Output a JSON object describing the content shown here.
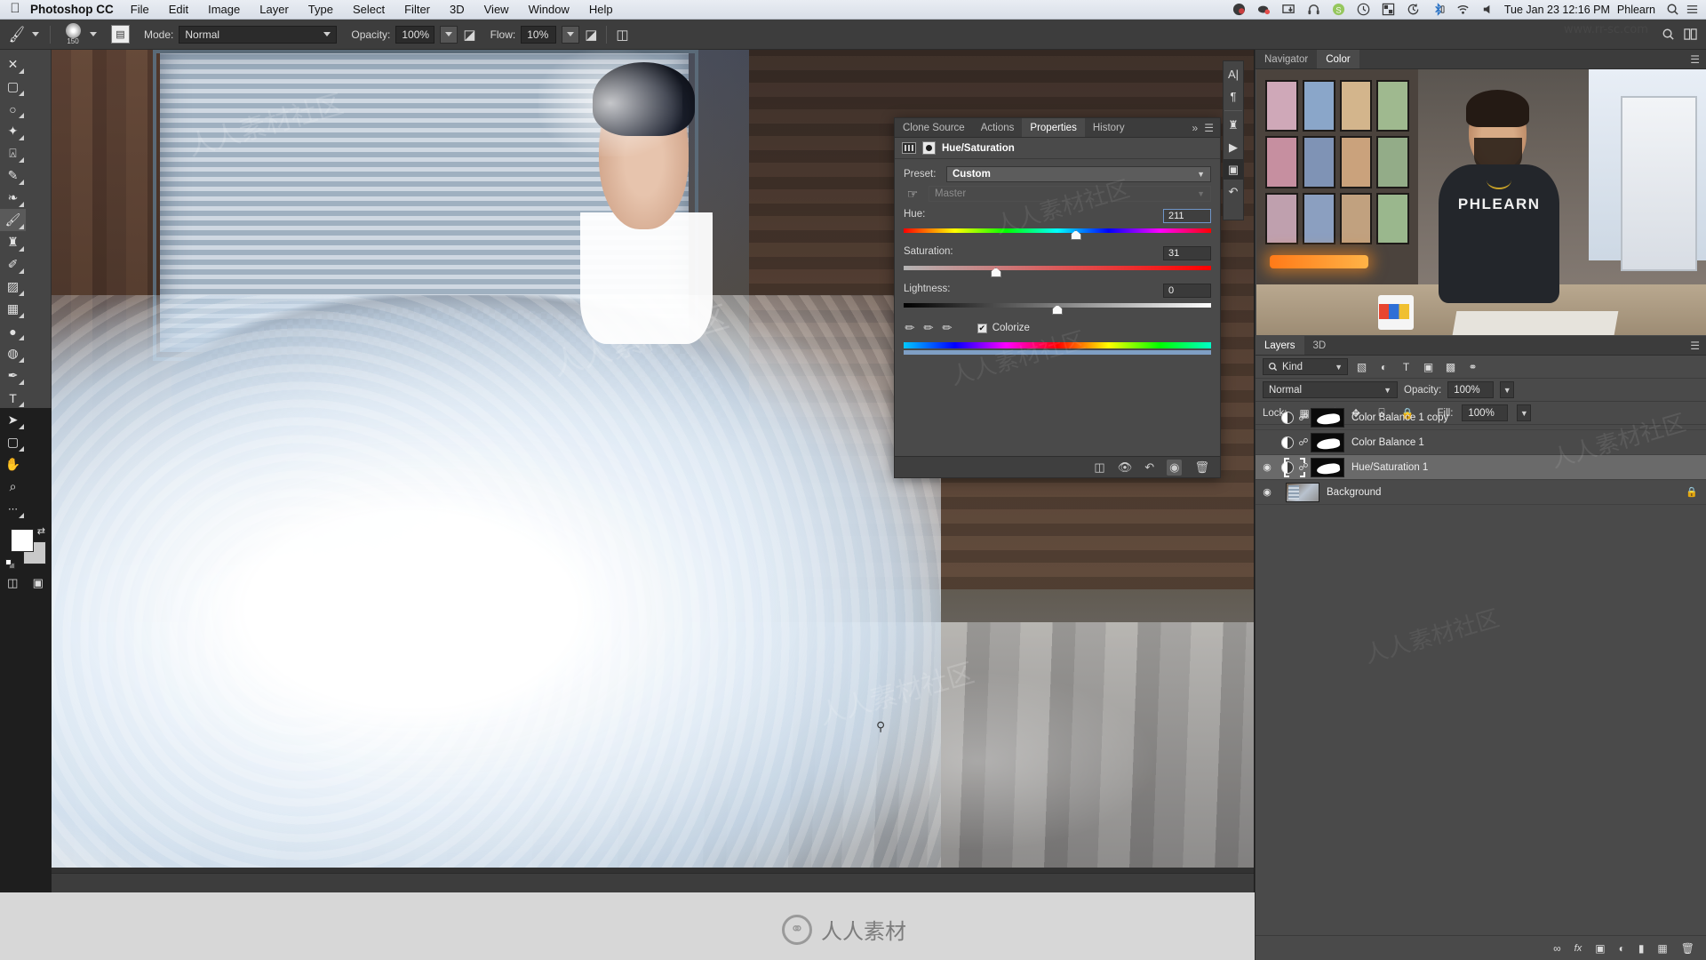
{
  "menubar": {
    "apple_icon": "apple-icon",
    "app_name": "Photoshop CC",
    "items": [
      "File",
      "Edit",
      "Image",
      "Layer",
      "Type",
      "Select",
      "Filter",
      "3D",
      "View",
      "Window",
      "Help"
    ],
    "tray_icons": [
      "dropbox-icon",
      "cloud-sync-icon",
      "display-link-icon",
      "headphone-icon",
      "skype-icon",
      "clock-icon",
      "grid-icon",
      "timemachine-icon",
      "bluetooth-icon",
      "wifi-icon",
      "input-source-icon",
      "battery-icon",
      "volume-icon"
    ],
    "datetime": "Tue Jan 23  12:16 PM",
    "user": "Phlearn",
    "search_icon": "search-icon",
    "control_center_icon": "list-icon"
  },
  "optionsbar": {
    "tool_icon": "brush-tool-icon",
    "brush_size": "150",
    "tablet_pressure_icon": "tablet-icon",
    "mode_label": "Mode:",
    "mode_value": "Normal",
    "opacity_label": "Opacity:",
    "opacity_value": "100%",
    "opacity_pressure_icon": "pressure-opacity-icon",
    "flow_label": "Flow:",
    "flow_value": "10%",
    "airbrush_icon": "airbrush-icon",
    "smoothing_icon": "smoothing-icon",
    "search_icon": "search-icon",
    "arrange_icon": "arrange-icon"
  },
  "toolbar": {
    "tools": [
      {
        "name": "move-tool",
        "glyph": "✥",
        "active": false
      },
      {
        "name": "marquee-tool",
        "glyph": "▭",
        "active": false
      },
      {
        "name": "lasso-tool",
        "glyph": "◯",
        "active": false
      },
      {
        "name": "magic-wand-tool",
        "glyph": "✧",
        "active": false
      },
      {
        "name": "crop-tool",
        "glyph": "⌗",
        "active": false
      },
      {
        "name": "eyedropper-tool",
        "glyph": "✎",
        "active": false
      },
      {
        "name": "healing-brush-tool",
        "glyph": "❥",
        "active": false
      },
      {
        "name": "brush-tool",
        "glyph": "🖌",
        "active": true
      },
      {
        "name": "clone-stamp-tool",
        "glyph": "♜",
        "active": false
      },
      {
        "name": "history-brush-tool",
        "glyph": "✐",
        "active": false
      },
      {
        "name": "eraser-tool",
        "glyph": "◨",
        "active": false
      },
      {
        "name": "gradient-tool",
        "glyph": "▦",
        "active": false
      },
      {
        "name": "blur-tool",
        "glyph": "💧",
        "active": false
      },
      {
        "name": "dodge-tool",
        "glyph": "◍",
        "active": false
      },
      {
        "name": "pen-tool",
        "glyph": "✒",
        "active": false
      },
      {
        "name": "type-tool",
        "glyph": "T",
        "active": false
      },
      {
        "name": "path-selection-tool",
        "glyph": "➤",
        "active": false
      },
      {
        "name": "shape-tool",
        "glyph": "▢",
        "active": false
      },
      {
        "name": "hand-tool",
        "glyph": "✋",
        "active": false
      },
      {
        "name": "zoom-tool",
        "glyph": "⌕",
        "active": false
      },
      {
        "name": "edit-toolbar-tool",
        "glyph": "•••",
        "active": false
      }
    ],
    "foreground_color": "#ffffff",
    "background_color": "#c9c9c9",
    "swap_icon": "swap-colors-icon",
    "default_colors_icon": "default-colors-icon",
    "quickmask_icon": "quick-mask-icon",
    "screenmode_icon": "screen-mode-icon"
  },
  "properties": {
    "tabs": [
      {
        "label": "Clone Source",
        "active": false
      },
      {
        "label": "Actions",
        "active": false
      },
      {
        "label": "Properties",
        "active": true
      },
      {
        "label": "History",
        "active": false
      }
    ],
    "overflow_icon": "chevron-double-right-icon",
    "menu_icon": "panel-menu-icon",
    "adjustment_title": "Hue/Saturation",
    "preset_label": "Preset:",
    "preset_value": "Custom",
    "channel_value": "Master",
    "hand_icon": "targeted-adjust-icon",
    "sliders": [
      {
        "label": "Hue:",
        "value": "211",
        "pos": 56,
        "active": true
      },
      {
        "label": "Saturation:",
        "value": "31",
        "pos": 30,
        "active": false
      },
      {
        "label": "Lightness:",
        "value": "0",
        "pos": 50,
        "active": false
      }
    ],
    "eyedropper_icons": [
      "eyedropper-icon",
      "eyedropper-add-icon",
      "eyedropper-subtract-icon"
    ],
    "colorize_label": "Colorize",
    "colorize_checked": true,
    "check_glyph": "✔",
    "footer_icons": [
      "clip-to-layer-icon",
      "view-previous-icon",
      "reset-icon",
      "toggle-visibility-icon",
      "delete-icon"
    ]
  },
  "vstrip": {
    "icons": [
      {
        "name": "character-panel-icon",
        "glyph": "A|"
      },
      {
        "name": "paragraph-panel-icon",
        "glyph": "¶"
      },
      {
        "name": "clone-source-panel-icon",
        "glyph": "⛃"
      },
      {
        "name": "timeline-panel-icon",
        "glyph": "▶"
      },
      {
        "name": "properties-panel-icon",
        "glyph": "▣",
        "active": true
      },
      {
        "name": "history-panel-icon",
        "glyph": "⮌"
      }
    ]
  },
  "navigator_panel": {
    "tabs": [
      {
        "label": "Navigator",
        "active": false
      },
      {
        "label": "Color",
        "active": true
      }
    ],
    "menu_icon": "panel-menu-icon",
    "webcam_shirt_text": "PHLEARN"
  },
  "layers_panel": {
    "tabs": [
      {
        "label": "Layers",
        "active": true
      },
      {
        "label": "3D",
        "active": false
      }
    ],
    "menu_icon": "panel-menu-icon",
    "filter_kind_label": "Kind",
    "filter_search_icon": "search-icon",
    "filter_icons": [
      "filter-pixel-icon",
      "filter-adjustment-icon",
      "filter-type-icon",
      "filter-shape-icon",
      "filter-smart-icon",
      "filter-toggle-icon"
    ],
    "blend_mode": "Normal",
    "opacity_label": "Opacity:",
    "opacity_value": "100%",
    "lock_label": "Lock:",
    "lock_icons": [
      "lock-transparency-icon",
      "lock-image-icon",
      "lock-position-icon",
      "lock-artboard-icon",
      "lock-all-icon"
    ],
    "fill_label": "Fill:",
    "fill_value": "100%",
    "layers": [
      {
        "name": "Color Balance 1 copy",
        "visible": false,
        "selected": false,
        "kind": "adjustment",
        "linked": true
      },
      {
        "name": "Color Balance 1",
        "visible": false,
        "selected": false,
        "kind": "adjustment",
        "linked": true
      },
      {
        "name": "Hue/Saturation 1",
        "visible": true,
        "selected": true,
        "kind": "adjustment",
        "linked": true
      },
      {
        "name": "Background",
        "visible": true,
        "selected": false,
        "kind": "background",
        "locked": true
      }
    ],
    "eye_glyph": "◉",
    "link_glyph": "⛓",
    "lock_glyph": "🔒",
    "footer_icons": [
      "link-layers-icon",
      "layer-style-icon",
      "add-mask-icon",
      "new-adjustment-icon",
      "new-group-icon",
      "new-layer-icon",
      "delete-layer-icon"
    ],
    "footer_glyphs": [
      "∞",
      "fx",
      "▣",
      "◐",
      "▭",
      "▤",
      "🗑"
    ]
  },
  "watermarks": {
    "text_small": "人人素材社区",
    "brand": "人人素材",
    "url": "www.rr-sc.com"
  },
  "canvas": {
    "cursor_icon": "brush-cursor-icon"
  }
}
